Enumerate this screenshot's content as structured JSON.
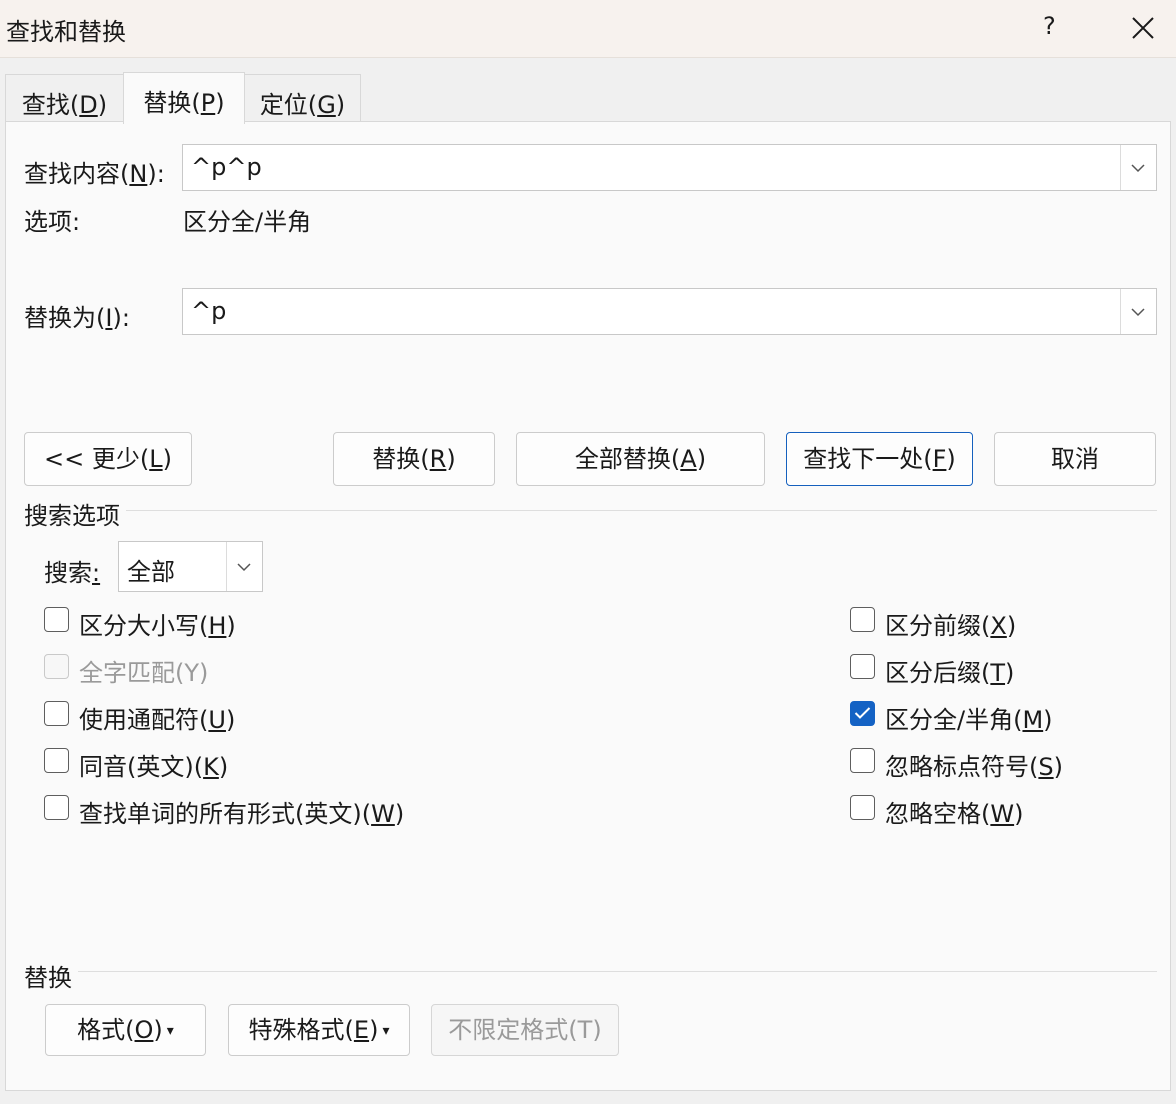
{
  "window": {
    "title": "查找和替换",
    "help": "?"
  },
  "tabs": [
    {
      "label": "查找(",
      "key": "D",
      "end": ")"
    },
    {
      "label": "替换(",
      "key": "P",
      "end": ")"
    },
    {
      "label": "定位(",
      "key": "G",
      "end": ")"
    }
  ],
  "find": {
    "label_pre": "查找内容(",
    "label_key": "N",
    "label_post": "):",
    "value": "^p^p",
    "options_label": "选项:",
    "options_value": "区分全/半角"
  },
  "replace": {
    "label_pre": "替换为(",
    "label_key": "I",
    "label_post": "):",
    "value": "^p"
  },
  "buttons": {
    "less_pre": "<< 更少(",
    "less_key": "L",
    "less_post": ")",
    "replace_pre": "替换(",
    "replace_key": "R",
    "replace_post": ")",
    "replace_all_pre": "全部替换(",
    "replace_all_key": "A",
    "replace_all_post": ")",
    "find_next_pre": "查找下一处(",
    "find_next_key": "F",
    "find_next_post": ")",
    "cancel": "取消"
  },
  "search_options": {
    "heading": "搜索选项",
    "search_label_pre": "搜索",
    "search_label_key": ":",
    "search_value": "全部",
    "left": [
      {
        "pre": "区分大小写(",
        "key": "H",
        "post": ")",
        "checked": false,
        "disabled": false
      },
      {
        "text": "全字匹配(Y)",
        "checked": false,
        "disabled": true
      },
      {
        "pre": "使用通配符(",
        "key": "U",
        "post": ")",
        "checked": false,
        "disabled": false
      },
      {
        "pre": "同音(英文)(",
        "key": "K",
        "post": ")",
        "checked": false,
        "disabled": false
      },
      {
        "pre": "查找单词的所有形式(英文)(",
        "key": "W",
        "post": ")",
        "checked": false,
        "disabled": false
      }
    ],
    "right": [
      {
        "pre": "区分前缀(",
        "key": "X",
        "post": ")",
        "checked": false
      },
      {
        "pre": "区分后缀(",
        "key": "T",
        "post": ")",
        "checked": false
      },
      {
        "pre": "区分全/半角(",
        "key": "M",
        "post": ")",
        "checked": true
      },
      {
        "pre": "忽略标点符号(",
        "key": "S",
        "post": ")",
        "checked": false
      },
      {
        "pre": "忽略空格(",
        "key": "W",
        "post": ")",
        "checked": false
      }
    ]
  },
  "replace_section": {
    "heading": "替换",
    "format_pre": "格式(",
    "format_key": "O",
    "format_post": ")",
    "special_pre": "特殊格式(",
    "special_key": "E",
    "special_post": ")",
    "no_format": "不限定格式(T)"
  },
  "colors": {
    "accent": "#1462c4",
    "default_button_border": "#1560bd",
    "titlebar": "#f7f2ee"
  }
}
